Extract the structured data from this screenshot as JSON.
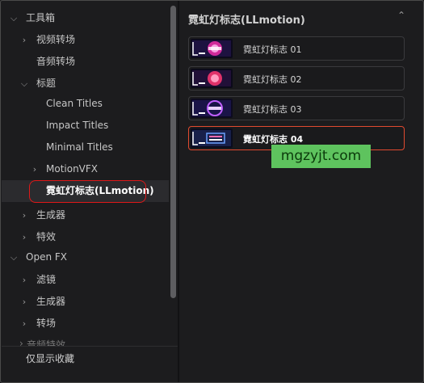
{
  "tree": {
    "items": [
      {
        "label": "工具箱",
        "level": 0,
        "chevron": "chevron-down-icon",
        "expanded": true
      },
      {
        "label": "视频转场",
        "level": 1,
        "chevron": "chevron-right-icon",
        "expanded": false
      },
      {
        "label": "音频转场",
        "level": 1,
        "chevron": "",
        "expanded": false
      },
      {
        "label": "标题",
        "level": 1,
        "chevron": "chevron-down-icon",
        "expanded": true
      },
      {
        "label": "Clean Titles",
        "level": 2,
        "chevron": ""
      },
      {
        "label": "Impact Titles",
        "level": 2,
        "chevron": ""
      },
      {
        "label": "Minimal Titles",
        "level": 2,
        "chevron": ""
      },
      {
        "label": "MotionVFX",
        "level": 2,
        "chevron": "chevron-right-icon",
        "expanded": false
      },
      {
        "label": "霓虹灯标志(LLmotion)",
        "level": 2,
        "chevron": "",
        "selected": true
      },
      {
        "label": "生成器",
        "level": 1,
        "chevron": "chevron-right-icon",
        "expanded": false
      },
      {
        "label": "特效",
        "level": 1,
        "chevron": "chevron-right-icon",
        "expanded": false
      },
      {
        "label": "Open FX",
        "level": 0,
        "chevron": "chevron-down-icon",
        "expanded": true
      },
      {
        "label": "滤镜",
        "level": 1,
        "chevron": "chevron-right-icon",
        "expanded": false
      },
      {
        "label": "生成器",
        "level": 1,
        "chevron": "chevron-right-icon",
        "expanded": false
      },
      {
        "label": "转场",
        "level": 1,
        "chevron": "chevron-right-icon",
        "expanded": false
      }
    ],
    "partially_hidden_item": "音频特效",
    "favorites_only_label": "仅显示收藏"
  },
  "content": {
    "title": "霓虹灯标志(LLmotion)",
    "collapse_icon": "chevron-up-icon",
    "clips": [
      {
        "label": "霓虹灯标志 01",
        "active": false
      },
      {
        "label": "霓虹灯标志 02",
        "active": false
      },
      {
        "label": "霓虹灯标志 03",
        "active": false
      },
      {
        "label": "霓虹灯标志 04",
        "active": true
      }
    ]
  },
  "watermark": "mgzyjt.com",
  "colors": {
    "background": "#1c1c1e",
    "selection_ring": "#e01818",
    "active_clip_border": "#e04a30",
    "watermark_bg": "#5ec35e"
  }
}
